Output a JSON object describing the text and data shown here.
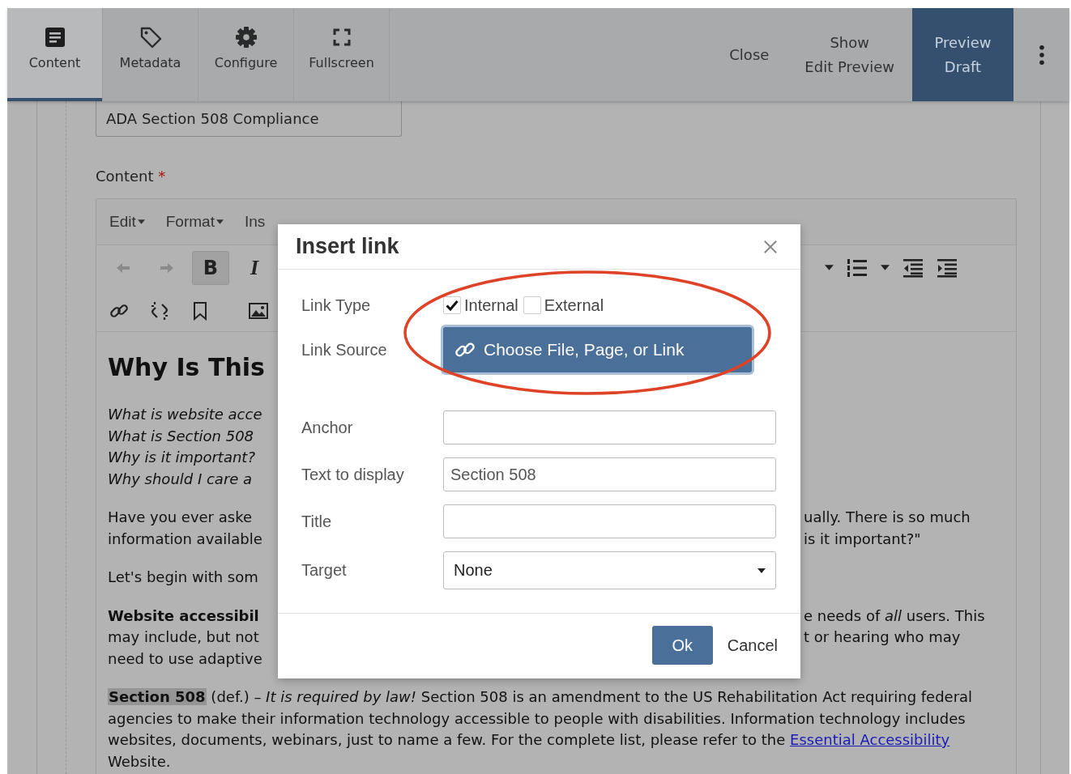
{
  "tabs": [
    {
      "label": "Content",
      "selected": true
    },
    {
      "label": "Metadata",
      "selected": false
    },
    {
      "label": "Configure",
      "selected": false
    },
    {
      "label": "Fullscreen",
      "selected": false
    }
  ],
  "actions": [
    {
      "kind": "plain",
      "lines": [
        "Close"
      ]
    },
    {
      "kind": "plain",
      "lines": [
        "Show",
        "Edit Preview"
      ]
    },
    {
      "kind": "primary",
      "lines": [
        "Preview",
        "Draft"
      ]
    }
  ],
  "title_field": {
    "value": "ADA Section 508 Compliance"
  },
  "content_label": {
    "text": "Content",
    "required_mark": "*"
  },
  "editor": {
    "menus": [
      "Edit",
      "Format",
      "Ins"
    ],
    "toolbar_left": [
      {
        "kind": "undo",
        "disabled": true,
        "selected": false
      },
      {
        "kind": "redo",
        "disabled": true,
        "selected": false
      },
      {
        "kind": "bold",
        "label": "B",
        "disabled": false,
        "selected": true
      },
      {
        "kind": "italic",
        "label": "I",
        "disabled": false,
        "selected": false
      }
    ],
    "toolbar_right": [
      {
        "kind": "caret"
      },
      {
        "kind": "numbered_list"
      },
      {
        "kind": "caret"
      },
      {
        "kind": "outdent"
      },
      {
        "kind": "indent"
      }
    ],
    "toolbar_row2": [
      {
        "kind": "link"
      },
      {
        "kind": "unlink"
      },
      {
        "kind": "bookmark"
      },
      {
        "kind": "image"
      }
    ],
    "heading": "Why Is This",
    "questions": [
      "What is website acce",
      "What is Section 508",
      "Why is it important?",
      "Why should I care a"
    ],
    "paragraphs": [
      {
        "left": [
          "Have you ever aske",
          "information available"
        ],
        "right": [
          "ually. There is so much",
          "is it important?\""
        ]
      },
      {
        "left": [
          "Let's begin with som"
        ]
      },
      {
        "left": [
          "**Website accessibil**",
          "may include, but not",
          "need to use adaptive"
        ],
        "right": [
          "e needs of *all* users. This",
          "t or hearing who may"
        ]
      }
    ],
    "final_paragraph": {
      "highlighted": true,
      "before": "**Section 508** (def.) – *It is required by law!* Section 508 is an amendment to the US Rehabilitation Act requiring federal agencies to make their information technology accessible to people with disabilities. Information technology includes websites, documents, webinars, just to name a few. For the complete list, please refer to the",
      "link": "Essential Accessibility",
      "after": "Website."
    }
  },
  "dialog": {
    "title": "Insert link",
    "link_type": {
      "label": "Link Type",
      "options": [
        {
          "label": "Internal",
          "checked": true
        },
        {
          "label": "External",
          "checked": false
        }
      ]
    },
    "link_source": {
      "label": "Link Source",
      "button": "Choose File, Page, or Link"
    },
    "fields": [
      {
        "label": "Anchor",
        "kind": "text"
      },
      {
        "label": "Text to display",
        "kind": "text",
        "value": "Section 508"
      },
      {
        "label": "Title",
        "kind": "text"
      },
      {
        "label": "Target",
        "kind": "select",
        "value": "None"
      }
    ],
    "buttons": [
      {
        "label": "Ok",
        "kind": "primary"
      },
      {
        "label": "Cancel",
        "kind": "plain"
      }
    ]
  }
}
